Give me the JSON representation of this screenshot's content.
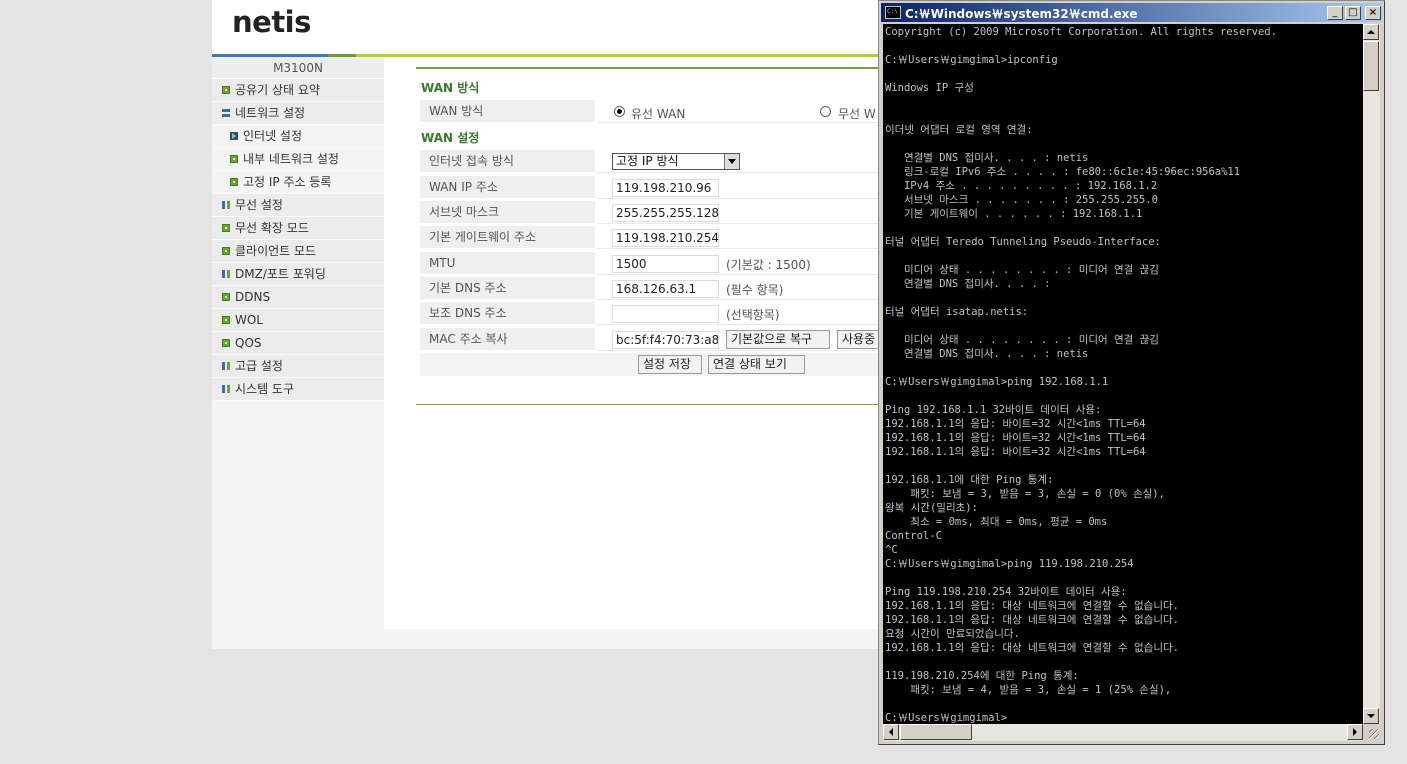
{
  "router": {
    "logo": "netis",
    "model": "M3100N",
    "nav": [
      {
        "label": "공유기 상태 요약",
        "icon": "green-square-icon"
      },
      {
        "label": "네트워크 설정",
        "icon": "bars-icon"
      },
      {
        "label": "인터넷 설정",
        "icon": "play-arrow-icon"
      },
      {
        "label": "내부 네트워크 설정",
        "icon": "green-square-icon"
      },
      {
        "label": "고정 IP 주소 등록",
        "icon": "green-square-icon"
      },
      {
        "label": "무선 설정",
        "icon": "grid-icon"
      },
      {
        "label": "무선 확장 모드",
        "icon": "green-square-icon"
      },
      {
        "label": "클라이언트 모드",
        "icon": "green-square-icon"
      },
      {
        "label": "DMZ/포트 포워딩",
        "icon": "grid-icon"
      },
      {
        "label": "DDNS",
        "icon": "green-square-icon"
      },
      {
        "label": "WOL",
        "icon": "green-square-icon"
      },
      {
        "label": "QOS",
        "icon": "green-square-icon"
      },
      {
        "label": "고급 설정",
        "icon": "grid-icon"
      },
      {
        "label": "시스템 도구",
        "icon": "grid-icon"
      }
    ],
    "wan_type_section": "WAN 방식",
    "wan_type_label": "WAN 방식",
    "wan_options": [
      "유선 WAN",
      "무선 W"
    ],
    "wan_settings_section": "WAN 설정",
    "fields": {
      "conn_method": {
        "label": "인터넷 접속 방식",
        "value": "고정 IP 방식"
      },
      "wan_ip": {
        "label": "WAN IP 주소",
        "value": "119.198.210.96"
      },
      "subnet": {
        "label": "서브넷 마스크",
        "value": "255.255.255.128"
      },
      "gateway": {
        "label": "기본 게이트웨이 주소",
        "value": "119.198.210.254"
      },
      "mtu": {
        "label": "MTU",
        "value": "1500",
        "hint": "(기본값 : 1500)"
      },
      "dns1": {
        "label": "기본 DNS 주소",
        "value": "168.126.63.1",
        "hint": "(필수 항목)"
      },
      "dns2": {
        "label": "보조 DNS 주소",
        "value": "",
        "hint": "(선택항목)"
      },
      "mac": {
        "label": "MAC 주소 복사",
        "value": "bc:5f:f4:70:73:a8",
        "restore_button": "기본값으로 복구",
        "use_button": "사용중"
      }
    },
    "save_button": "설정 저장",
    "status_button": "연결 상태 보기"
  },
  "cmd": {
    "title": "C:￦Windows￦system32￦cmd.exe",
    "minimize": "_",
    "maximize": "□",
    "close": "×",
    "lines": [
      "Copyright (c) 2009 Microsoft Corporation. All rights reserved.",
      "",
      "C:￦Users￦gimgimal>ipconfig",
      "",
      "Windows IP 구성",
      "",
      "",
      "이더넷 어댑터 로컬 영역 연결:",
      "",
      "   연결별 DNS 접미사. . . . : netis",
      "   링크-로컬 IPv6 주소 . . . . : fe80::6c1e:45:96ec:956a%11",
      "   IPv4 주소 . . . . . . . . . : 192.168.1.2",
      "   서브넷 마스크 . . . . . . . : 255.255.255.0",
      "   기본 게이트웨이 . . . . . . : 192.168.1.1",
      "",
      "터널 어댑터 Teredo Tunneling Pseudo-Interface:",
      "",
      "   미디어 상태 . . . . . . . . : 미디어 연결 끊김",
      "   연결별 DNS 접미사. . . . :",
      "",
      "터널 어댑터 isatap.netis:",
      "",
      "   미디어 상태 . . . . . . . . : 미디어 연결 끊김",
      "   연결별 DNS 접미사. . . . : netis",
      "",
      "C:￦Users￦gimgimal>ping 192.168.1.1",
      "",
      "Ping 192.168.1.1 32바이트 데이터 사용:",
      "192.168.1.1의 응답: 바이트=32 시간<1ms TTL=64",
      "192.168.1.1의 응답: 바이트=32 시간<1ms TTL=64",
      "192.168.1.1의 응답: 바이트=32 시간<1ms TTL=64",
      "",
      "192.168.1.1에 대한 Ping 통계:",
      "    패킷: 보냄 = 3, 받음 = 3, 손실 = 0 (0% 손실),",
      "왕복 시간(밀리초):",
      "    최소 = 0ms, 최대 = 0ms, 평균 = 0ms",
      "Control-C",
      "^C",
      "C:￦Users￦gimgimal>ping 119.198.210.254",
      "",
      "Ping 119.198.210.254 32바이트 데이터 사용:",
      "192.168.1.1의 응답: 대상 네트워크에 연결할 수 없습니다.",
      "192.168.1.1의 응답: 대상 네트워크에 연결할 수 없습니다.",
      "요청 시간이 만료되었습니다.",
      "192.168.1.1의 응답: 대상 네트워크에 연결할 수 없습니다.",
      "",
      "119.198.210.254에 대한 Ping 통계:",
      "    패킷: 보냄 = 4, 받음 = 3, 손실 = 1 (25% 손실),",
      "",
      "C:￦Users￦gimgimal>"
    ]
  }
}
